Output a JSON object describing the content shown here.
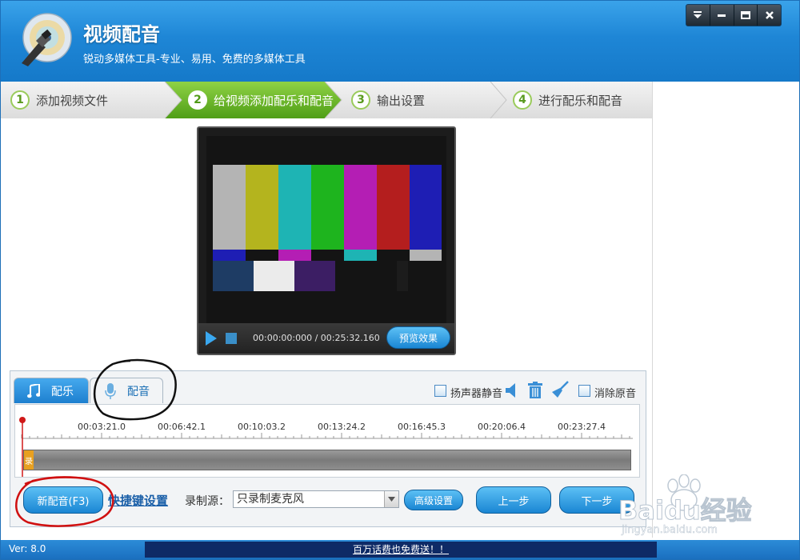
{
  "window": {
    "title": "视频配音",
    "subtitle": "锐动多媒体工具-专业、易用、免费的多媒体工具"
  },
  "steps": [
    {
      "num": "1",
      "label": "添加视频文件",
      "active": false
    },
    {
      "num": "2",
      "label": "给视频添加配乐和配音",
      "active": true
    },
    {
      "num": "3",
      "label": "输出设置",
      "active": false
    },
    {
      "num": "4",
      "label": "进行配乐和配音",
      "active": false
    }
  ],
  "player": {
    "time": "00:00:00:000 / 00:25:32.160",
    "preview_label": "预览效果"
  },
  "tabs": {
    "music_label": "配乐",
    "dub_label": "配音"
  },
  "options": {
    "speaker_mute": "扬声器静音",
    "remove_original": "消除原音"
  },
  "timeline": {
    "ticks": [
      "00:03:21.0",
      "00:06:42.1",
      "00:10:03.2",
      "00:13:24.2",
      "00:16:45.3",
      "00:20:06.4",
      "00:23:27.4"
    ],
    "rec_marker": "录"
  },
  "controls": {
    "new_dub_label": "新配音(F3)",
    "shortcut_link": "快捷键设置",
    "source_label": "录制源：",
    "source_value": "只录制麦克风",
    "advanced_label": "高级设置",
    "prev_label": "上一步",
    "next_label": "下一步"
  },
  "status": {
    "version": "Ver: 8.0",
    "promo": "百万话费也免费送！！"
  },
  "watermark": {
    "line1": "Baidu经验",
    "line2": "jingyan.baidu.com"
  },
  "colors": {
    "header_blue": "#1e86d6",
    "active_step_green": "#5aae1e",
    "button_blue": "#1a86d3"
  }
}
